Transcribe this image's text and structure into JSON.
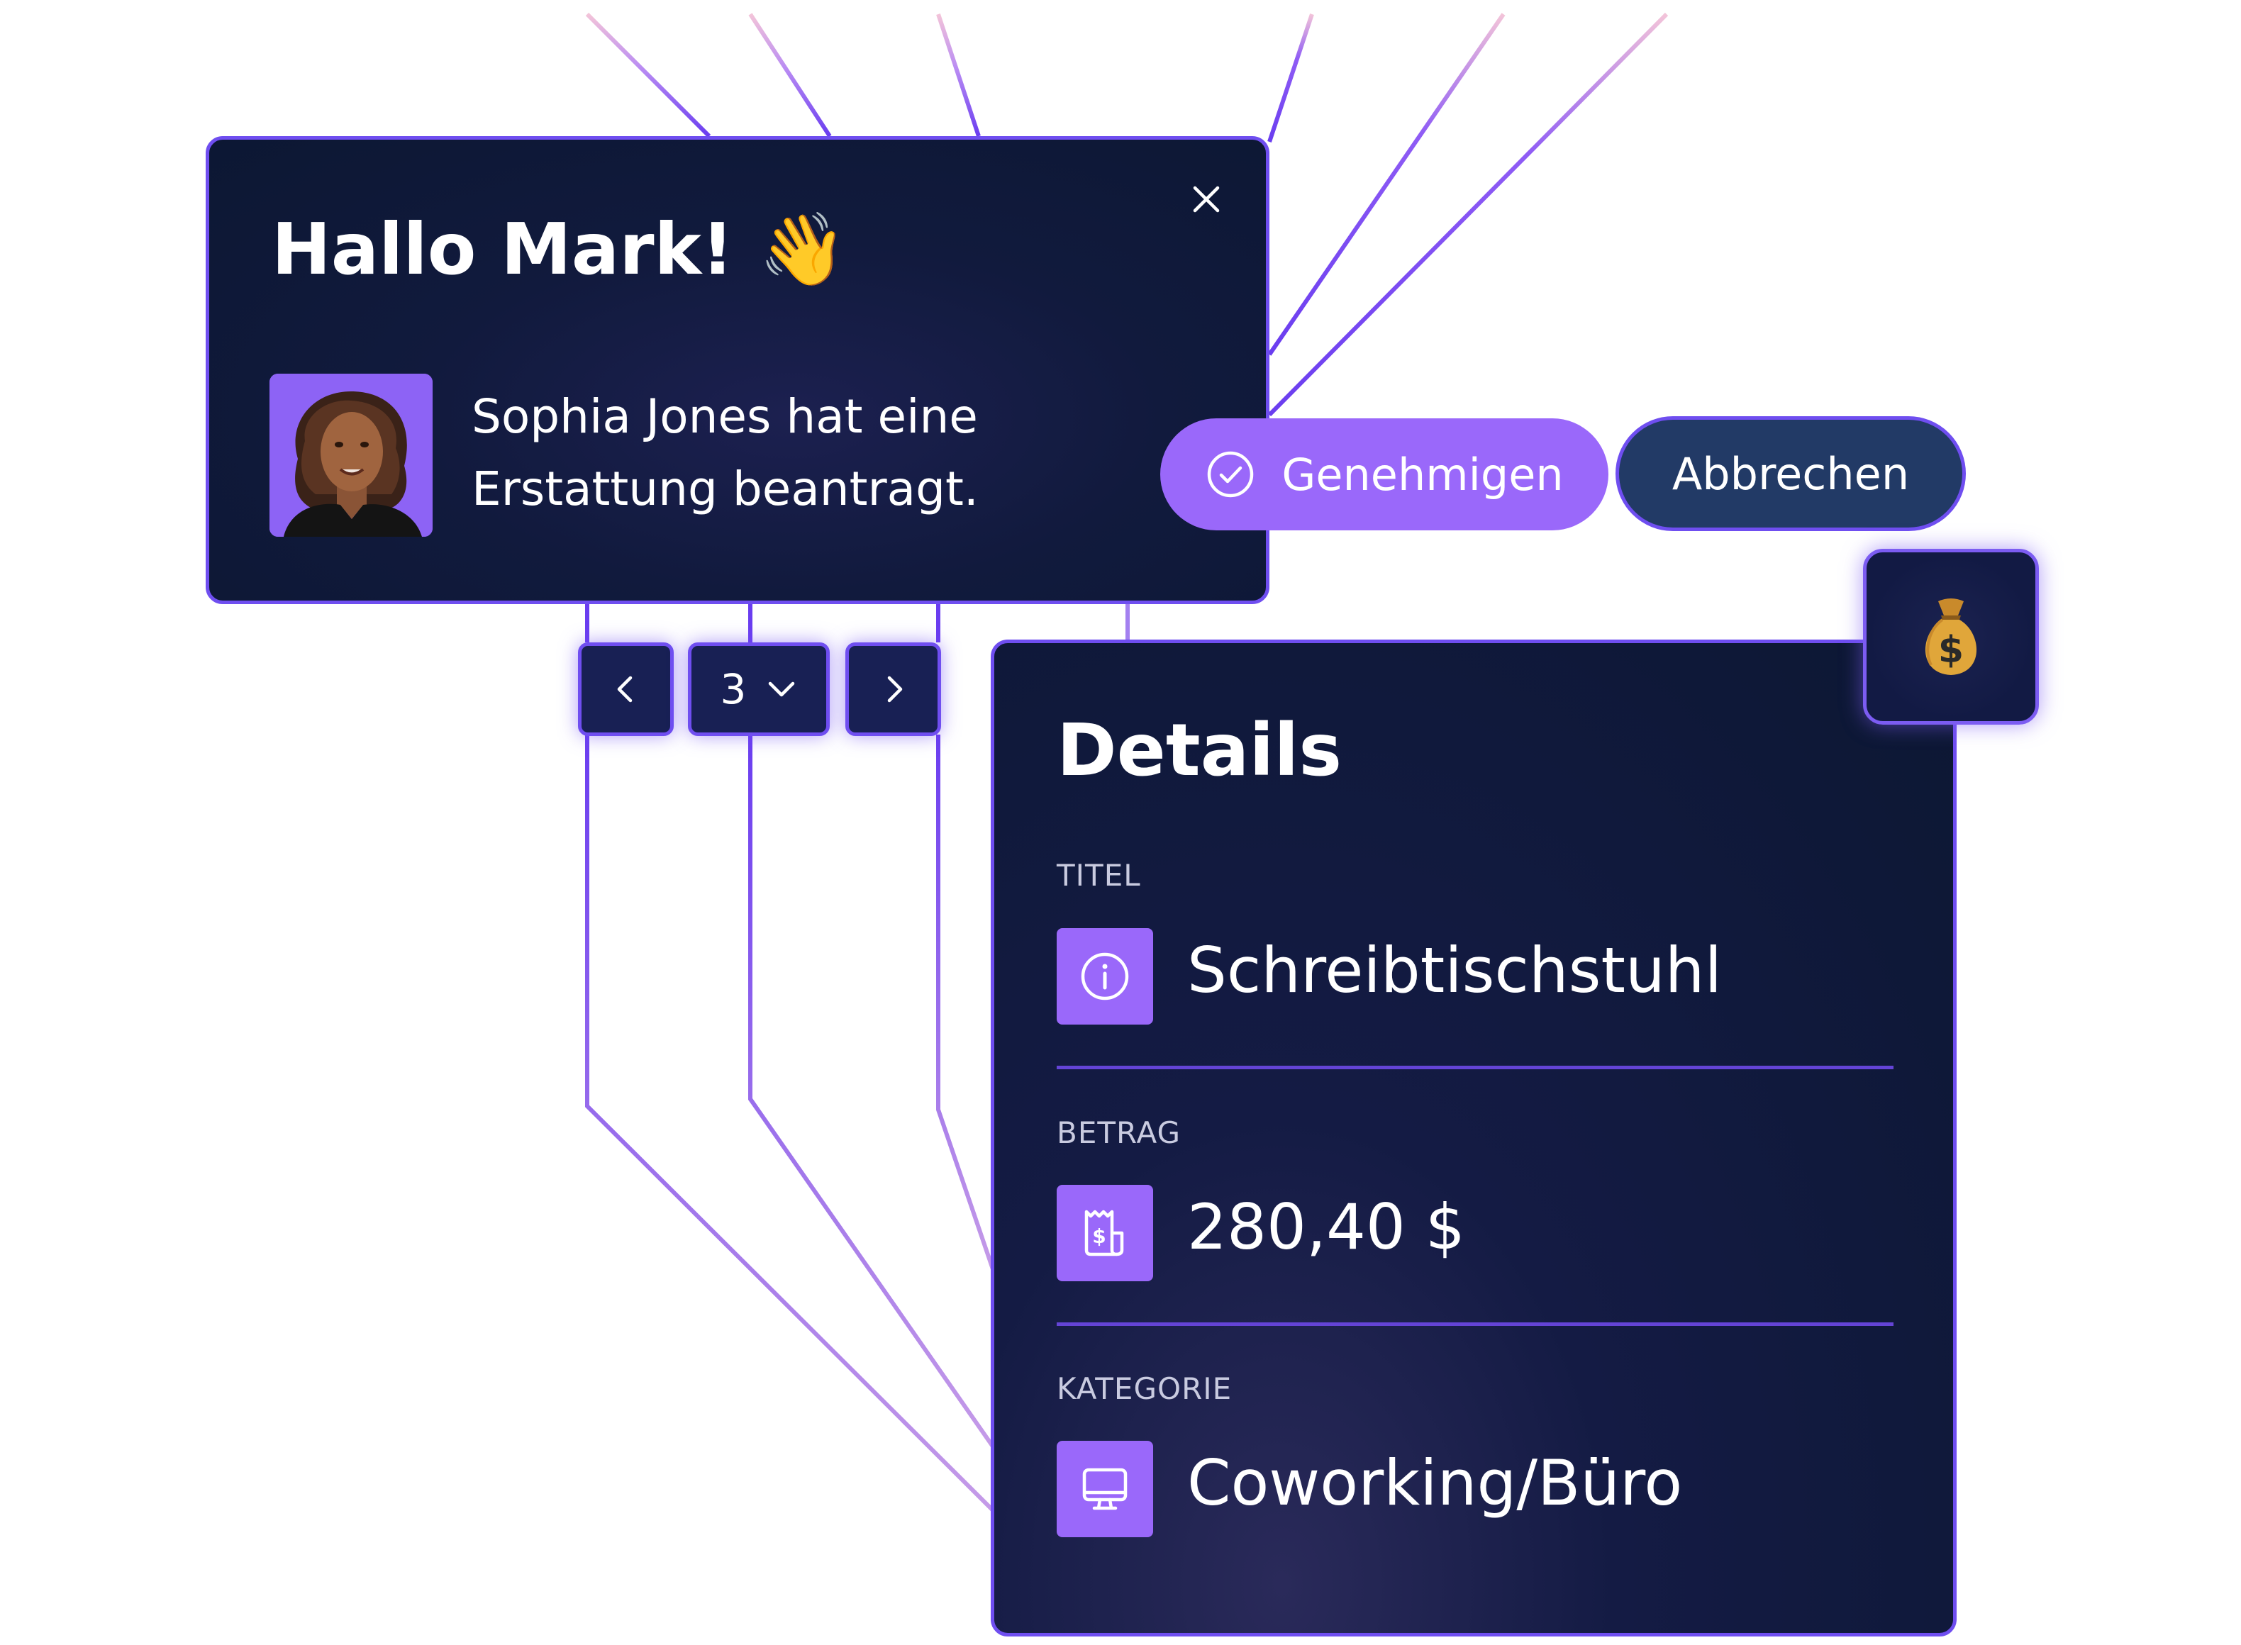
{
  "notification": {
    "greeting": "Hallo Mark!",
    "wave_emoji": "👋",
    "message": "Sophia Jones hat eine\nErstattung beantragt.",
    "avatar": "avatar-photo",
    "close_icon": "close-icon"
  },
  "actions": {
    "approve_label": "Genehmigen",
    "approve_icon": "check-circle-icon",
    "cancel_label": "Abbrechen"
  },
  "pager": {
    "prev_icon": "chevron-left-icon",
    "current_page": "3",
    "dropdown_icon": "chevron-down-icon",
    "next_icon": "chevron-right-icon"
  },
  "badge": {
    "emoji": "💰",
    "icon": "money-bag-icon"
  },
  "details": {
    "title": "Details",
    "fields": [
      {
        "label": "TITEL",
        "value": "Schreibtischstuhl",
        "icon": "info-icon"
      },
      {
        "label": "BETRAG",
        "value": "280,40 $",
        "icon": "receipt-dollar-icon"
      },
      {
        "label": "KATEGORIE",
        "value": "Coworking/Büro",
        "icon": "monitor-icon"
      }
    ]
  },
  "colors": {
    "accent": "#9a68fa",
    "border": "#6f4ef0",
    "panel_bg": "#0c1733",
    "cancel_bg": "#223a66",
    "text": "#ffffff",
    "muted_text": "#c9cbe0"
  }
}
